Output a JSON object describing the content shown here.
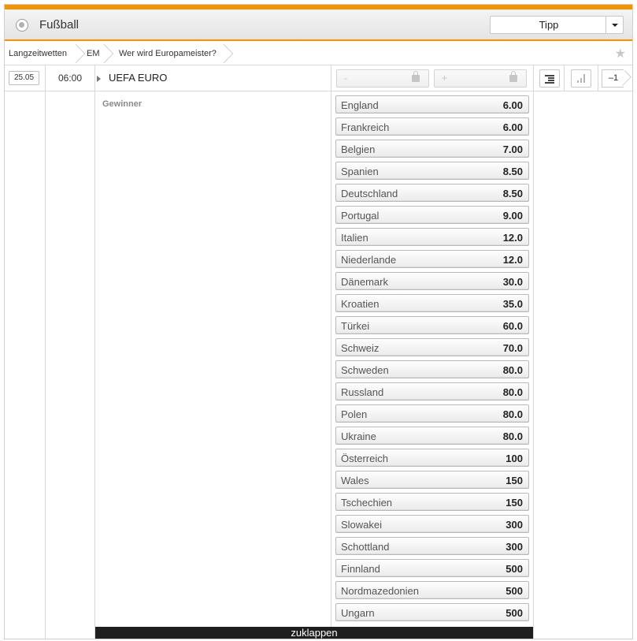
{
  "header": {
    "sport_title": "Fußball",
    "sport_icon": "football-icon",
    "accent_color": "#f29400",
    "bet_type_select": {
      "selected": "Tipp"
    }
  },
  "breadcrumb": {
    "items": [
      "Langzeitwetten",
      "EM",
      "Wer wird Europameister?"
    ],
    "favorite_icon": "star-icon"
  },
  "event": {
    "date": "25.05",
    "time": "06:00",
    "name": "UEFA EURO",
    "minus_field": "-",
    "plus_field": "+",
    "more_markets": "–1"
  },
  "market": {
    "label": "Gewinner",
    "selections": [
      {
        "team": "England",
        "odds": "6.00"
      },
      {
        "team": "Frankreich",
        "odds": "6.00"
      },
      {
        "team": "Belgien",
        "odds": "7.00"
      },
      {
        "team": "Spanien",
        "odds": "8.50"
      },
      {
        "team": "Deutschland",
        "odds": "8.50"
      },
      {
        "team": "Portugal",
        "odds": "9.00"
      },
      {
        "team": "Italien",
        "odds": "12.0"
      },
      {
        "team": "Niederlande",
        "odds": "12.0"
      },
      {
        "team": "Dänemark",
        "odds": "30.0"
      },
      {
        "team": "Kroatien",
        "odds": "35.0"
      },
      {
        "team": "Türkei",
        "odds": "60.0"
      },
      {
        "team": "Schweiz",
        "odds": "70.0"
      },
      {
        "team": "Schweden",
        "odds": "80.0"
      },
      {
        "team": "Russland",
        "odds": "80.0"
      },
      {
        "team": "Polen",
        "odds": "80.0"
      },
      {
        "team": "Ukraine",
        "odds": "80.0"
      },
      {
        "team": "Österreich",
        "odds": "100"
      },
      {
        "team": "Wales",
        "odds": "150"
      },
      {
        "team": "Tschechien",
        "odds": "150"
      },
      {
        "team": "Slowakei",
        "odds": "300"
      },
      {
        "team": "Schottland",
        "odds": "300"
      },
      {
        "team": "Finnland",
        "odds": "500"
      },
      {
        "team": "Nordmazedonien",
        "odds": "500"
      },
      {
        "team": "Ungarn",
        "odds": "500"
      }
    ]
  },
  "footer": {
    "collapse_label": "zuklappen"
  }
}
